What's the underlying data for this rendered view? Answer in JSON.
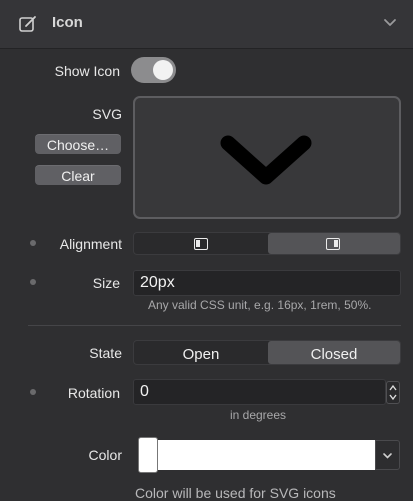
{
  "header": {
    "title": "Icon",
    "edit_icon": "edit-square-icon",
    "collapse_icon": "chevron-down-icon"
  },
  "show_icon": {
    "label": "Show Icon",
    "on": true
  },
  "svg": {
    "label": "SVG",
    "choose_label": "Choose…",
    "clear_label": "Clear",
    "preview_icon": "chevron-down-icon"
  },
  "alignment": {
    "label": "Alignment",
    "options": [
      "align-left-icon",
      "align-right-icon"
    ],
    "selected_index": 1
  },
  "size": {
    "label": "Size",
    "value": "20px",
    "hint": "Any valid CSS unit, e.g. 16px, 1rem, 50%."
  },
  "state": {
    "label": "State",
    "options": [
      "Open",
      "Closed"
    ],
    "selected_index": 1
  },
  "rotation": {
    "label": "Rotation",
    "value": "0",
    "hint": "in degrees"
  },
  "color": {
    "label": "Color",
    "value": "#ffffff",
    "note": "Color will be used for SVG icons"
  },
  "colors": {
    "background": "#2f2f31",
    "header": "#353538",
    "selected_segment": "#545457",
    "toggle_on": "#8c8c8e"
  }
}
